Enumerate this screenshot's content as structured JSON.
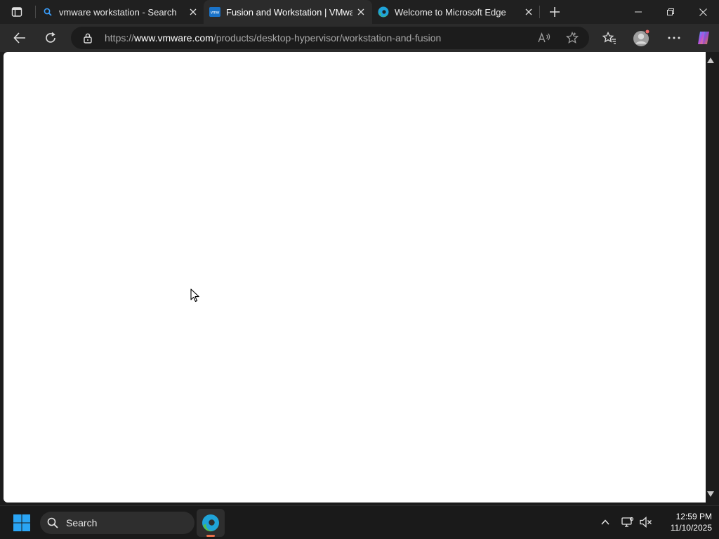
{
  "browser": {
    "tabs": [
      {
        "title": "vmware workstation - Search",
        "favicon": "search-icon",
        "active": false
      },
      {
        "title": "Fusion and Workstation | VMware",
        "favicon": "vmware-favicon",
        "active": true
      },
      {
        "title": "Welcome to Microsoft Edge",
        "favicon": "edge-favicon",
        "active": false
      }
    ],
    "address": {
      "scheme": "https://",
      "host": "www.vmware.com",
      "path": "/products/desktop-hypervisor/workstation-and-fusion"
    },
    "favicon_text": "vmw"
  },
  "taskbar": {
    "search_label": "Search",
    "time": "12:59 PM",
    "date": "11/10/2025"
  },
  "colors": {
    "accent": "#0078d4",
    "edge_blue": "#1fa3d8",
    "edge_green": "#54c14a",
    "running_indicator": "#e96e4a"
  }
}
